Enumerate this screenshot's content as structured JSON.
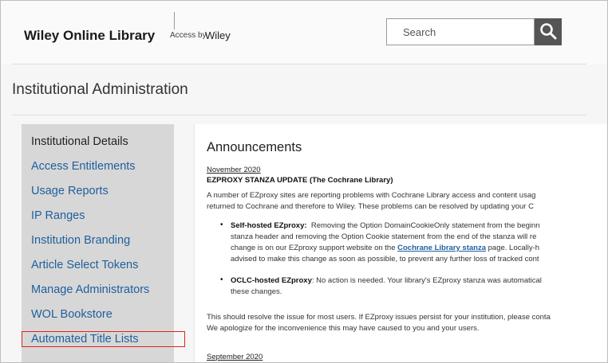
{
  "header": {
    "logo": "Wiley Online Library",
    "access_by_label": "Access by",
    "access_by_name": "Wiley",
    "search_placeholder": "Search"
  },
  "page": {
    "title": "Institutional Administration"
  },
  "sidebar": {
    "items": [
      {
        "label": "Institutional Details"
      },
      {
        "label": "Access Entitlements"
      },
      {
        "label": "Usage Reports"
      },
      {
        "label": "IP Ranges"
      },
      {
        "label": "Institution Branding"
      },
      {
        "label": "Article Select Tokens"
      },
      {
        "label": "Manage Administrators"
      },
      {
        "label": "WOL Bookstore"
      },
      {
        "label": "Automated Title Lists"
      }
    ]
  },
  "announcements": {
    "title": "Announcements",
    "date1": "November 2020",
    "headline": "EZPROXY STANZA UPDATE (The Cochrane Library)",
    "intro1": "A number of EZproxy sites are reporting problems with Cochrane Library access and content usag",
    "intro2": "returned to Cochrane and therefore to Wiley. These problems can be resolved by updating your C",
    "bullet1": {
      "label": "Self-hosted EZproxy:",
      "line1_rest": "Removing the Option DomainCookieOnly statement from the beginn",
      "line2": "stanza header and removing the Option Cookie statement from the end of the stanza will re",
      "line3_pre": "change is on our EZproxy support website on the",
      "line3_link": "Cochrane Library stanza",
      "line3_post": "page.  Locally-h",
      "line4": "advised to make this change as soon as possible, to prevent any further loss of tracked cont"
    },
    "bullet2": {
      "label": "OCLC-hosted EZproxy",
      "line1_rest": ":  No action is needed.  Your library's EZproxy stanza was automatical",
      "line2": "these changes."
    },
    "outro1": "This should resolve the issue for most users.  If EZproxy issues persist for your institution, please conta",
    "outro2": "We apologize for the inconvenience this may have caused to you and your users.",
    "date2": "September 2020"
  },
  "colors": {
    "link": "#1f5f9e",
    "sidebar_bg": "#d7d7d7",
    "highlight": "#e0241b"
  }
}
